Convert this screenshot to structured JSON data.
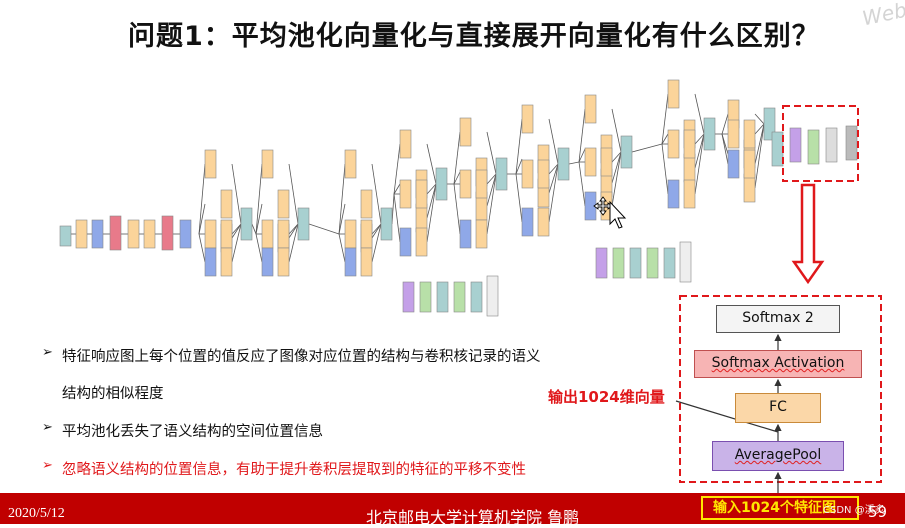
{
  "title": "问题1：平均池化向量化与直接展开向量化有什么区别？",
  "watermark": "Web",
  "bullets": [
    {
      "text": "特征响应图上每个位置的值反应了图像对应位置的结构与卷积核记录的语义",
      "color": "#111111"
    },
    {
      "text": "结构的相似程度",
      "color": "#111111"
    },
    {
      "text": "平均池化丢失了语义结构的空间位置信息",
      "color": "#111111"
    },
    {
      "text": "忽略语义结构的位置信息，有助于提升卷积层提取到的特征的平移不变性",
      "color": "#e0181b"
    }
  ],
  "bullet_marker": "➢",
  "stack": {
    "softmax2": "Softmax 2",
    "softmax_activation": "Softmax Activation",
    "fc": "FC",
    "average_pool": "AveragePool"
  },
  "output_label": "输出1024维向量",
  "footer": {
    "date": "2020/5/12",
    "organization": "北京邮电大学计算机学院  鲁鹏",
    "input_label": "输入1024个特征图",
    "csdn": "CSDN @溪炙",
    "page": "59"
  },
  "colors": {
    "footer_bg": "#c00000",
    "highlight_red": "#e0181b",
    "highlight_yellow": "#ffe600",
    "conv_orange": "#fbd49a",
    "pool_blue": "#8fa8e8",
    "norm_red": "#e87a8a",
    "concat_teal": "#a8d0d0",
    "softmax_purple": "#c4a0e8",
    "fc_green": "#b8e0a8"
  },
  "icons": [
    "down-arrow-icon",
    "cursor-icon",
    "move-cursor-icon",
    "bullet-arrow-icon"
  ]
}
